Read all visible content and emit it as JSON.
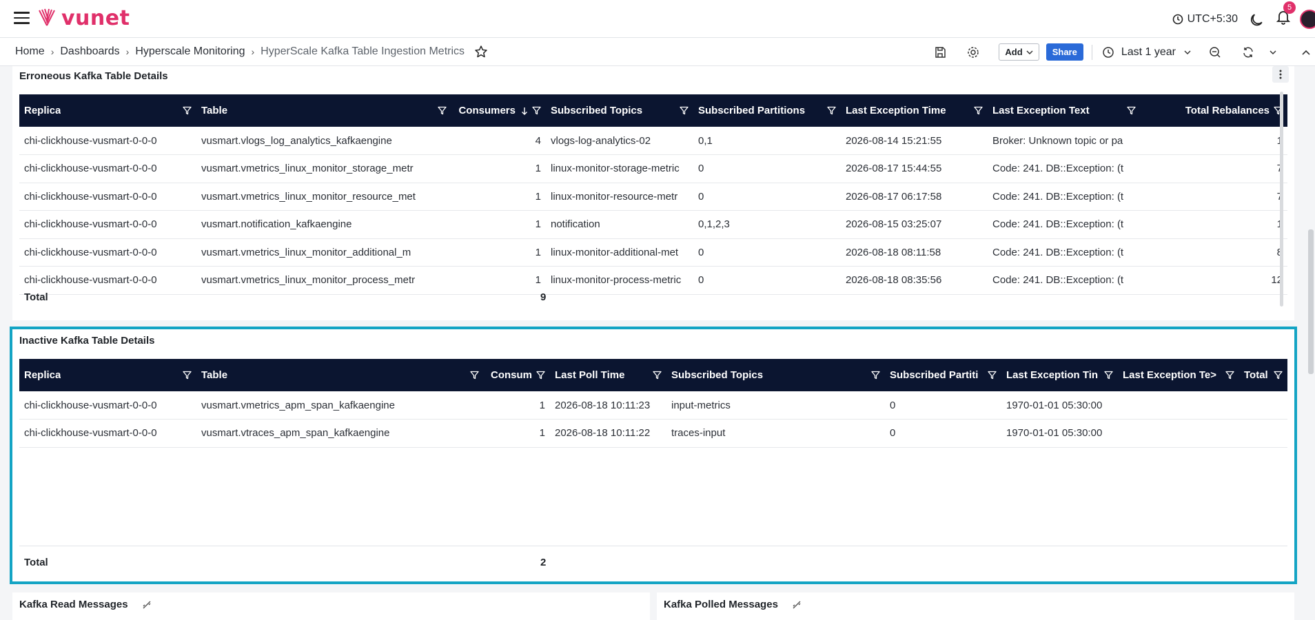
{
  "app": {
    "logo_text": "vunet",
    "brand_color": "#e0306a"
  },
  "topbar": {
    "timezone": "UTC+5:30",
    "notifications_count": "5"
  },
  "breadcrumb": [
    "Home",
    "Dashboards",
    "Hyperscale Monitoring",
    "HyperScale Kafka Table Ingestion Metrics"
  ],
  "toolbar": {
    "add_label": "Add",
    "share_label": "Share",
    "time_range": "Last 1 year"
  },
  "erroneous_panel": {
    "title": "Erroneous Kafka Table Details",
    "columns": [
      "Replica",
      "Table",
      "Consumers",
      "Subscribed Topics",
      "Subscribed Partitions",
      "Last Exception Time",
      "Last Exception Text",
      "Total Rebalances"
    ],
    "rows": [
      [
        "chi-clickhouse-vusmart-0-0-0",
        "vusmart.vlogs_log_analytics_kafkaengine",
        "4",
        "vlogs-log-analytics-02",
        "0,1",
        "2026-08-14 15:21:55",
        "Broker: Unknown topic or pa",
        "1"
      ],
      [
        "chi-clickhouse-vusmart-0-0-0",
        "vusmart.vmetrics_linux_monitor_storage_metr",
        "1",
        "linux-monitor-storage-metric",
        "0",
        "2026-08-17 15:44:55",
        "Code: 241. DB::Exception: (t",
        "7"
      ],
      [
        "chi-clickhouse-vusmart-0-0-0",
        "vusmart.vmetrics_linux_monitor_resource_met",
        "1",
        "linux-monitor-resource-metr",
        "0",
        "2026-08-17 06:17:58",
        "Code: 241. DB::Exception: (t",
        "7"
      ],
      [
        "chi-clickhouse-vusmart-0-0-0",
        "vusmart.notification_kafkaengine",
        "1",
        "notification",
        "0,1,2,3",
        "2026-08-15 03:25:07",
        "Code: 241. DB::Exception: (t",
        "1"
      ],
      [
        "chi-clickhouse-vusmart-0-0-0",
        "vusmart.vmetrics_linux_monitor_additional_m",
        "1",
        "linux-monitor-additional-met",
        "0",
        "2026-08-18 08:11:58",
        "Code: 241. DB::Exception: (t",
        "8"
      ],
      [
        "chi-clickhouse-vusmart-0-0-0",
        "vusmart.vmetrics_linux_monitor_process_metr",
        "1",
        "linux-monitor-process-metric",
        "0",
        "2026-08-18 08:35:56",
        "Code: 241. DB::Exception: (t",
        "12"
      ]
    ],
    "total_label": "Total",
    "total_value": "9"
  },
  "inactive_panel": {
    "title": "Inactive Kafka Table Details",
    "columns": [
      "Replica",
      "Table",
      "Consum",
      "Last Poll Time",
      "Subscribed Topics",
      "Subscribed Partiti",
      "Last Exception Tin",
      "Last Exception Te>",
      "Total Rel"
    ],
    "rows": [
      [
        "chi-clickhouse-vusmart-0-0-0",
        "vusmart.vmetrics_apm_span_kafkaengine",
        "1",
        "2026-08-18 10:11:23",
        "input-metrics",
        "0",
        "1970-01-01 05:30:00",
        "",
        ""
      ],
      [
        "chi-clickhouse-vusmart-0-0-0",
        "vusmart.vtraces_apm_span_kafkaengine",
        "1",
        "2026-08-18 10:11:22",
        "traces-input",
        "0",
        "1970-01-01 05:30:00",
        "",
        ""
      ]
    ],
    "total_label": "Total",
    "total_value": "2"
  },
  "bottom_panels": [
    "Kafka Read Messages",
    "Kafka Polled Messages"
  ],
  "colors": {
    "table_header": "#0b1530",
    "highlight": "#14a4c4",
    "share": "#2a6ad8"
  }
}
